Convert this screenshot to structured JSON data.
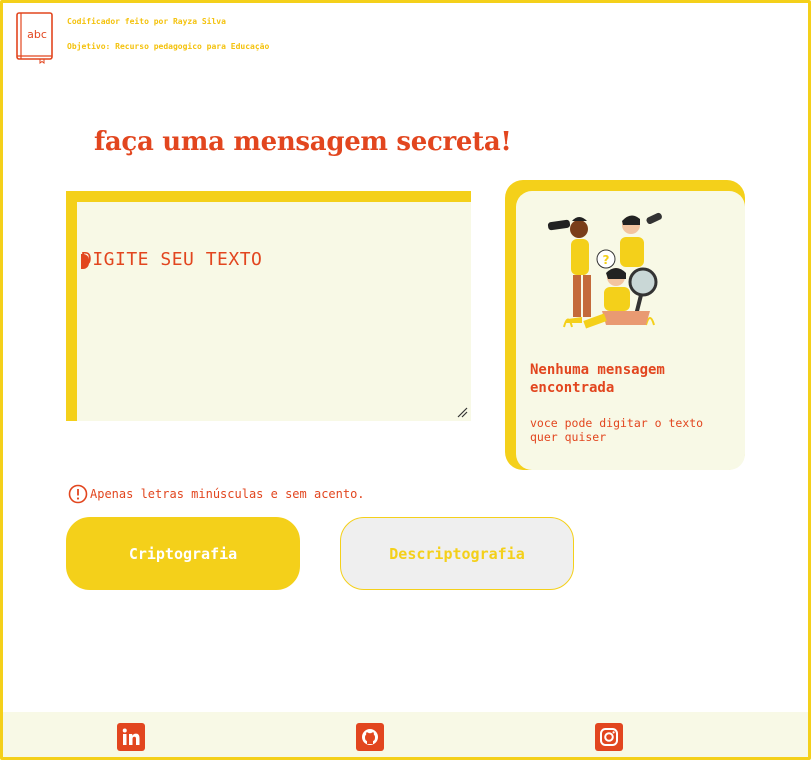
{
  "header": {
    "author_line": "Codificador feito por Rayza Silva",
    "objective_line": "Objetivo: Recurso pedagogico para Educação",
    "logo_text": "abc"
  },
  "title": "faça uma mensagem secreta!",
  "input": {
    "placeholder": "DIGITE SEU TEXTO",
    "value": ""
  },
  "result": {
    "title": "Nenhuma mensagem encontrada",
    "subtitle": "voce pode digitar o texto quer quiser"
  },
  "hint": "Apenas letras minúsculas e sem acento.",
  "buttons": {
    "encrypt": "Criptografia",
    "decrypt": "Descriptografia"
  },
  "footer": {
    "links": [
      {
        "icon": "linkedin-icon"
      },
      {
        "icon": "github-icon"
      },
      {
        "icon": "instagram-icon"
      }
    ]
  },
  "colors": {
    "accent_yellow": "#f4d01a",
    "accent_red": "#e2461f",
    "panel_bg": "#f8f9e6",
    "button_light": "#efefef"
  }
}
